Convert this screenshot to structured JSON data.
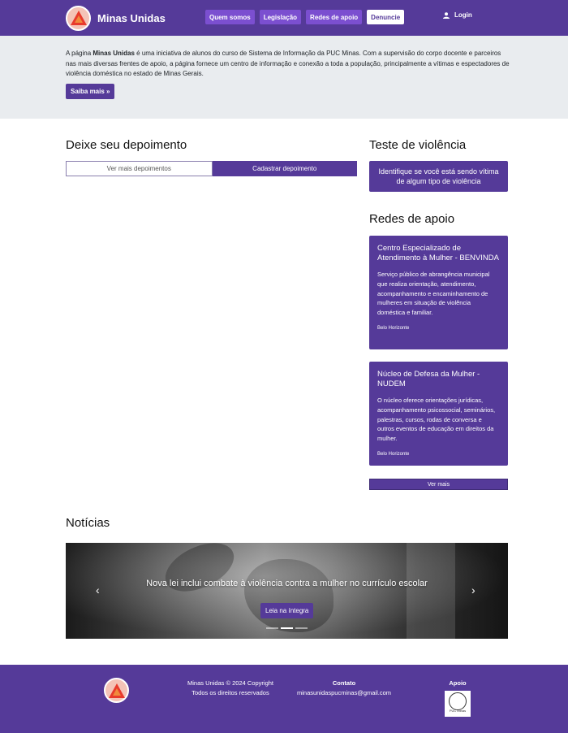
{
  "nav": {
    "brand": "Minas Unidas",
    "links": [
      "Quem somos",
      "Legislação",
      "Redes de apoio",
      "Denuncie"
    ],
    "login": "Login"
  },
  "hero": {
    "text_pre": "A página ",
    "text_bold": "Minas Unidas",
    "text_post": " é uma iniciativa de alunos do curso de Sistema de Informação da PUC Minas. Com a supervisão do corpo docente e parceiros nas mais diversas frentes de apoio, a página fornece um centro de informação e conexão a toda a população, principalmente a vítimas e espectadores de violência doméstica no estado de Minas Gerais.",
    "button": "Saiba mais »"
  },
  "depoimento": {
    "title": "Deixe seu depoimento",
    "tabs": [
      "Ver mais depoimentos",
      "Cadastrar depoimento"
    ]
  },
  "teste": {
    "title": "Teste de violência",
    "button": "Identifique se você está sendo vítima de algum tipo de violência"
  },
  "redes": {
    "title": "Redes de apoio",
    "cards": [
      {
        "title": "Centro Especializado de Atendimento à Mulher - BENVINDA",
        "text": "Serviço público de abrangência municipal que realiza orientação, atendimento, acompanhamento e encaminhamento de mulheres em situação de violência doméstica e familiar.",
        "location": "Belo Horizonte"
      },
      {
        "title": "Núcleo de Defesa da Mulher - NUDEM",
        "text": "O núcleo oferece orientações jurídicas, acompanhamento psicossocial, seminários, palestras, cursos, rodas de conversa e outros eventos de educação em direitos da mulher.",
        "location": "Belo Horizonte"
      }
    ],
    "ver_mais": "Ver mais"
  },
  "noticias": {
    "title": "Notícias",
    "slide_title": "Nova lei inclui combate à violência contra a mulher no currículo escolar",
    "slide_button": "Leia na íntegra",
    "prev": "‹",
    "next": "›"
  },
  "footer": {
    "copyright": "Minas Unidas © 2024 Copyright",
    "rights": "Todos os direitos reservados",
    "contact_head": "Contato",
    "contact_email": "minasunidaspucminas@gmail.com",
    "support_head": "Apoio",
    "seal_text": "PUC Minas"
  },
  "colors": {
    "primary": "#553a99",
    "accent": "#7b4fd0",
    "hero_bg": "#e9ecef"
  },
  "icons": [
    "logo-triangle-icon",
    "user-icon",
    "chevron-left-icon",
    "chevron-right-icon",
    "puc-seal-icon"
  ]
}
